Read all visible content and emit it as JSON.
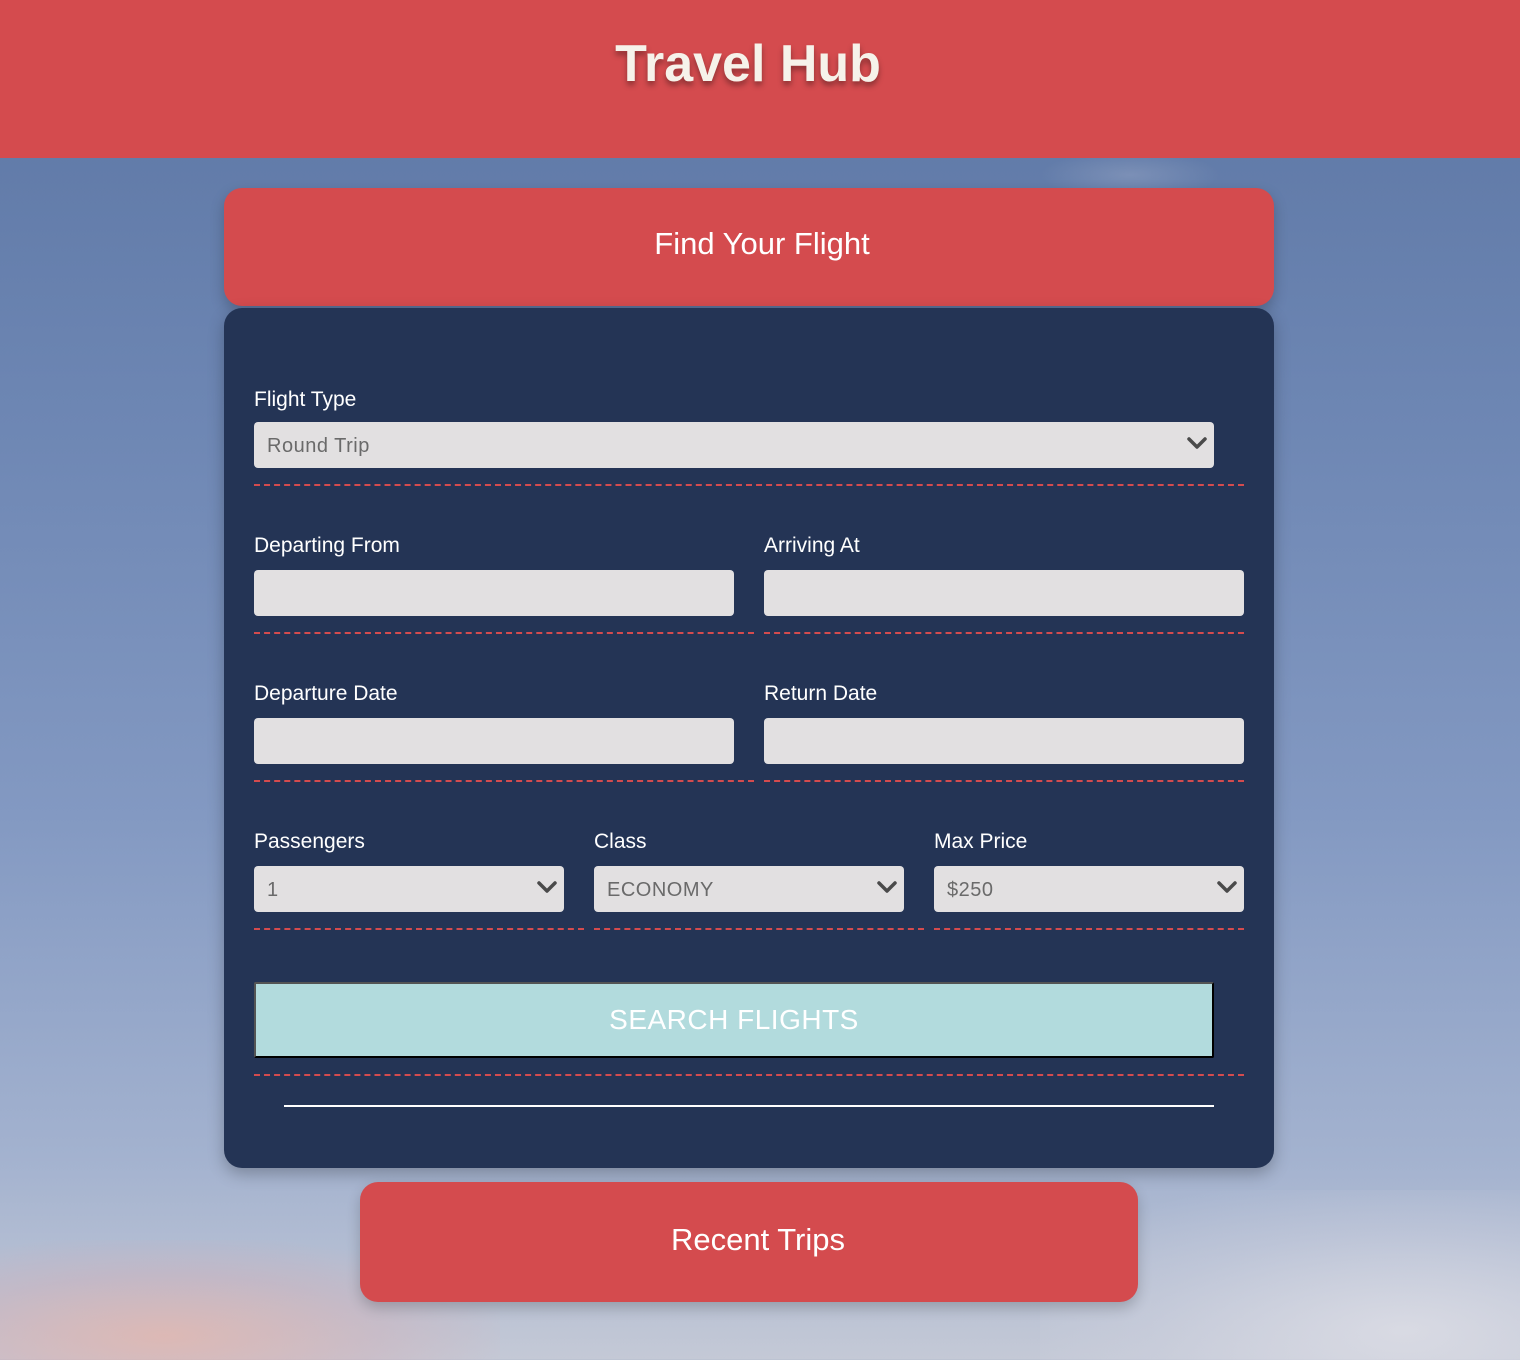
{
  "header": {
    "title": "Travel Hub"
  },
  "search_card": {
    "title": "Find Your Flight",
    "flight_type": {
      "label": "Flight Type",
      "value": "Round Trip"
    },
    "departing_from": {
      "label": "Departing From",
      "value": ""
    },
    "arriving_at": {
      "label": "Arriving At",
      "value": ""
    },
    "departure_date": {
      "label": "Departure Date",
      "value": ""
    },
    "return_date": {
      "label": "Return Date",
      "value": ""
    },
    "passengers": {
      "label": "Passengers",
      "value": "1"
    },
    "travel_class": {
      "label": "Class",
      "value": "ECONOMY"
    },
    "max_price": {
      "label": "Max Price",
      "value": "$250"
    },
    "search_button": "SEARCH FLIGHTS"
  },
  "recent_trips": {
    "label": "Recent Trips"
  },
  "colors": {
    "brand_red": "#d44b4e",
    "panel_navy": "#243455",
    "input_gray": "#e2e0e1",
    "search_button": "#b2dbdd"
  },
  "icons": [
    "chevron-down-icon"
  ]
}
